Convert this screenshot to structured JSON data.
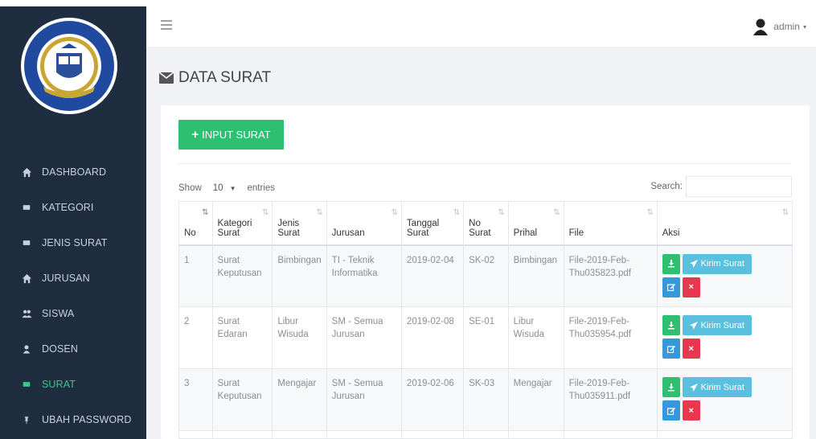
{
  "app": {
    "brand_colors": {
      "sidebar": "#1e2d40",
      "accent": "#2fbf71",
      "info": "#5bc0de",
      "primary": "#3498db",
      "danger": "#e8384f"
    }
  },
  "sidebar": {
    "logo_icon": "institute-seal-logo",
    "items": [
      {
        "label": "DASHBOARD",
        "icon": "home-icon",
        "active": false
      },
      {
        "label": "KATEGORI",
        "icon": "tag-icon",
        "active": false
      },
      {
        "label": "JENIS SURAT",
        "icon": "tag-icon",
        "active": false
      },
      {
        "label": "JURUSAN",
        "icon": "home-icon",
        "active": false
      },
      {
        "label": "SISWA",
        "icon": "users-icon",
        "active": false
      },
      {
        "label": "DOSEN",
        "icon": "user-icon",
        "active": false
      },
      {
        "label": "SURAT",
        "icon": "tag-icon",
        "active": true
      },
      {
        "label": "UBAH PASSWORD",
        "icon": "pin-icon",
        "active": false
      }
    ]
  },
  "topbar": {
    "user_name": "admin",
    "user_caret": "▾"
  },
  "page": {
    "title": "DATA SURAT"
  },
  "toolbar": {
    "input_label": "INPUT SURAT",
    "input_plus": "+"
  },
  "table_controls": {
    "show_label": "Show",
    "show_value": "10",
    "entries_label": "entries",
    "search_label": "Search:",
    "search_value": ""
  },
  "table": {
    "columns": [
      {
        "label": "No",
        "sort": "⇅"
      },
      {
        "label": "Kategori Surat",
        "sort": "⇅"
      },
      {
        "label": "Jenis Surat",
        "sort": "⇅"
      },
      {
        "label": "Jurusan",
        "sort": "⇅"
      },
      {
        "label": "Tanggal Surat",
        "sort": "⇅"
      },
      {
        "label": "No Surat",
        "sort": "⇅"
      },
      {
        "label": "Prihal",
        "sort": "⇅"
      },
      {
        "label": "File",
        "sort": "⇅"
      },
      {
        "label": "Aksi",
        "sort": "⇅"
      }
    ],
    "rows": [
      {
        "no": "1",
        "kategori": "Surat Keputusan",
        "jenis": "Bimbingan",
        "jurusan": "TI - Teknik Informatika",
        "tanggal": "2019-02-04",
        "no_surat": "SK-02",
        "prihal": "Bimbingan",
        "file": "File-2019-Feb-Thu035823.pdf"
      },
      {
        "no": "2",
        "kategori": "Surat Edaran",
        "jenis": "Libur Wisuda",
        "jurusan": "SM - Semua Jurusan",
        "tanggal": "2019-02-08",
        "no_surat": "SE-01",
        "prihal": "Libur Wisuda",
        "file": "File-2019-Feb-Thu035954.pdf"
      },
      {
        "no": "3",
        "kategori": "Surat Keputusan",
        "jenis": "Mengajar",
        "jurusan": "SM - Semua Jurusan",
        "tanggal": "2019-02-06",
        "no_surat": "SK-03",
        "prihal": "Mengajar",
        "file": "File-2019-Feb-Thu035911.pdf"
      }
    ],
    "actions": {
      "send_label": "Kirim Surat",
      "download_icon": "download-icon",
      "send_icon": "paper-plane-icon",
      "edit_icon": "edit-icon",
      "delete_icon": "close-icon",
      "delete_glyph": "×"
    }
  }
}
